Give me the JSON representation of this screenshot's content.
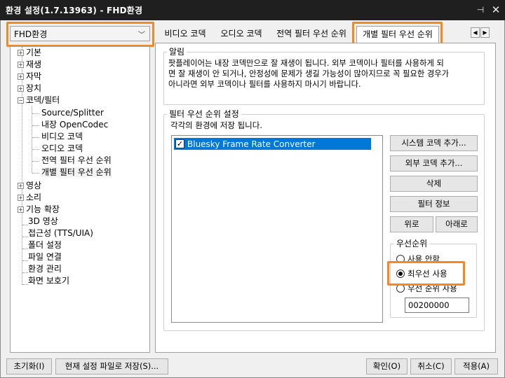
{
  "window": {
    "title": "환경 설정(1.7.13963) - FHD환경",
    "pin_icon": "pin-icon",
    "close_icon": "close-icon"
  },
  "profile": {
    "selected": "FHD환경"
  },
  "tree": {
    "items": [
      {
        "label": "기본",
        "expandable": true
      },
      {
        "label": "재생",
        "expandable": true
      },
      {
        "label": "자막",
        "expandable": true
      },
      {
        "label": "장치",
        "expandable": true
      },
      {
        "label": "코덱/필터",
        "expandable": true,
        "expanded": true
      },
      {
        "label": "Source/Splitter"
      },
      {
        "label": "내장 OpenCodec"
      },
      {
        "label": "비디오 코덱"
      },
      {
        "label": "오디오 코덱"
      },
      {
        "label": "전역 필터 우선 순위"
      },
      {
        "label": "개별 필터 우선 순위",
        "selected": true
      },
      {
        "label": "영상",
        "expandable": true
      },
      {
        "label": "소리",
        "expandable": true
      },
      {
        "label": "기능 확장",
        "expandable": true
      },
      {
        "label": "3D 영상"
      },
      {
        "label": "접근성 (TTS/UIA)"
      },
      {
        "label": "폴더 설정"
      },
      {
        "label": "파일 연결"
      },
      {
        "label": "환경 관리"
      },
      {
        "label": "화면 보호기"
      }
    ]
  },
  "tabs": [
    {
      "label": "비디오 코덱"
    },
    {
      "label": "오디오 코덱"
    },
    {
      "label": "전역 필터 우선 순위"
    },
    {
      "label": "개별 필터 우선 순위",
      "active": true
    }
  ],
  "notice": {
    "title": "알림",
    "lines": [
      "팟플레이어는 내장 코덱만으로 잘 재생이 됩니다. 외부 코덱이나 필터를 사용하게 되",
      "면 잘 재생이 안 되거나, 안정성에 문제가 생길 가능성이 많아지므로 꼭 필요한 경우가",
      "아니라면 외부 코덱이나 필터를 사용하지 마시기 바랍니다."
    ]
  },
  "filter_priority": {
    "title": "필터 우선 순위 설정",
    "caption": "각각의 환경에 저장 됩니다.",
    "list": [
      {
        "label": "Bluesky Frame Rate Converter",
        "checked": true,
        "selected": true
      }
    ],
    "buttons": {
      "add_system_codec": "시스템 코덱 추가...",
      "add_external_codec": "외부 코덱 추가...",
      "delete": "삭제",
      "filter_info": "필터 정보",
      "up": "위로",
      "down": "아래로"
    },
    "priority": {
      "title": "우선순위",
      "options": [
        {
          "label": "사용 안함",
          "selected": false
        },
        {
          "label": "최우선 사용",
          "selected": true
        },
        {
          "label": "우선 순위 사용",
          "selected": false
        }
      ],
      "value": "00200000"
    }
  },
  "footer": {
    "reset": "초기화(I)",
    "save_current": "현재 설정 파일로 저장(S)...",
    "ok": "확인(O)",
    "cancel": "취소(C)",
    "apply": "적용(A)"
  },
  "accent_color": "#f08a24",
  "selection_color": "#0078d7"
}
